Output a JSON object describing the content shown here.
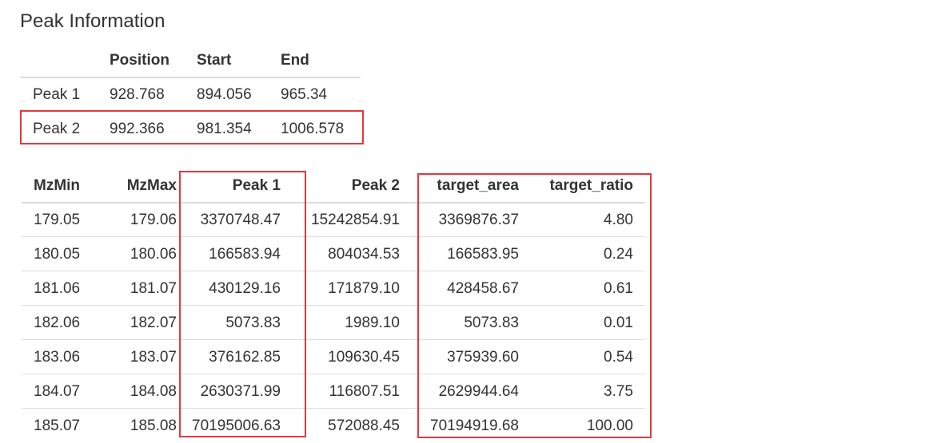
{
  "title": "Peak Information",
  "peak_table": {
    "headers": [
      "",
      "Position",
      "Start",
      "End"
    ],
    "rows": [
      [
        "Peak 1",
        "928.768",
        "894.056",
        "965.34"
      ],
      [
        "Peak 2",
        "992.366",
        "981.354",
        "1006.578"
      ]
    ],
    "highlighted_row": "Peak 2"
  },
  "mz_table": {
    "headers": [
      "MzMin",
      "MzMax",
      "Peak 1",
      "Peak 2",
      "target_area",
      "target_ratio"
    ],
    "rows": [
      [
        "179.05",
        "179.06",
        "3370748.47",
        "15242854.91",
        "3369876.37",
        "4.80"
      ],
      [
        "180.05",
        "180.06",
        "166583.94",
        "804034.53",
        "166583.95",
        "0.24"
      ],
      [
        "181.06",
        "181.07",
        "430129.16",
        "171879.10",
        "428458.67",
        "0.61"
      ],
      [
        "182.06",
        "182.07",
        "5073.83",
        "1989.10",
        "5073.83",
        "0.01"
      ],
      [
        "183.06",
        "183.07",
        "376162.85",
        "109630.45",
        "375939.60",
        "0.54"
      ],
      [
        "184.07",
        "184.08",
        "2630371.99",
        "116807.51",
        "2629944.64",
        "3.75"
      ],
      [
        "185.07",
        "185.08",
        "70195006.63",
        "572088.45",
        "70194919.68",
        "100.00"
      ]
    ],
    "highlighted_columns": [
      "Peak 1",
      "target_area",
      "target_ratio"
    ]
  },
  "colors": {
    "text": "#333333",
    "rule": "#dddddd",
    "highlight_border": "#e0393e",
    "background": "#ffffff"
  }
}
